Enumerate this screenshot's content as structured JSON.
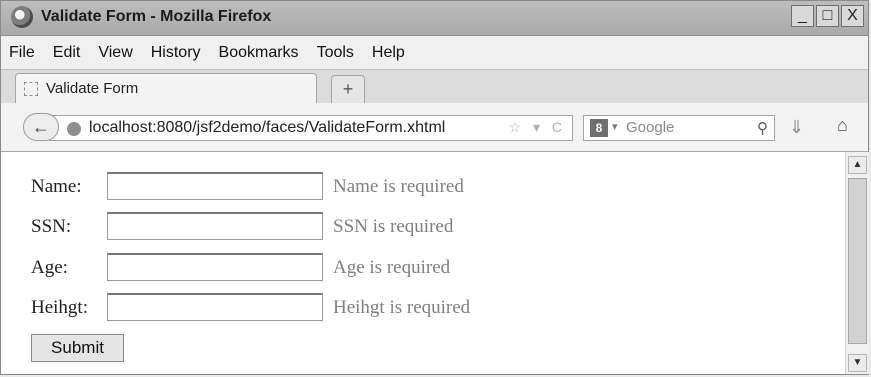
{
  "window": {
    "title": "Validate Form - Mozilla Firefox",
    "buttons": [
      "_",
      "□",
      "X"
    ]
  },
  "menu": [
    "File",
    "Edit",
    "View",
    "History",
    "Bookmarks",
    "Tools",
    "Help"
  ],
  "tab": {
    "label": "Validate Form",
    "new_tab_label": "+"
  },
  "nav": {
    "back_glyph": "←",
    "url": "localhost:8080/jsf2demo/faces/ValidateForm.xhtml",
    "url_icons": "☆ ▾ C",
    "search_engine_icon": "8",
    "search_caret": "▾",
    "search_placeholder": "Google",
    "search_glyph": "⚲",
    "download_glyph": "⇓",
    "home_glyph": "⌂"
  },
  "form": {
    "fields": [
      {
        "label": "Name:",
        "value": "",
        "message": "Name is required"
      },
      {
        "label": "SSN:",
        "value": "",
        "message": "SSN is required"
      },
      {
        "label": "Age:",
        "value": "",
        "message": "Age is required"
      },
      {
        "label": "Heihgt:",
        "value": "",
        "message": "Heihgt is required"
      }
    ],
    "submit_label": "Submit"
  },
  "scrollbar": {
    "up_glyph": "▲",
    "down_glyph": "▼"
  }
}
